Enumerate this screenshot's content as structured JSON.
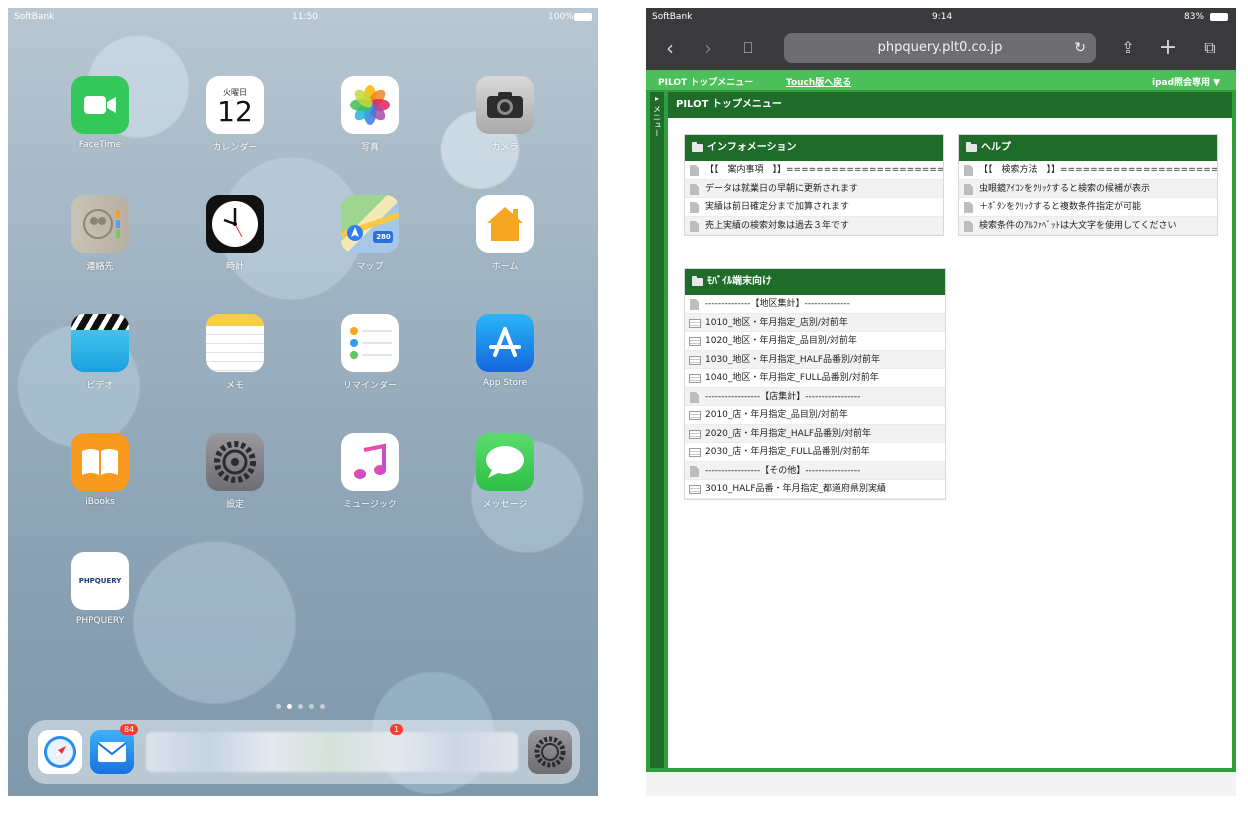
{
  "home": {
    "status": {
      "carrier": "SoftBank",
      "time": "11:50",
      "battery": "100%"
    },
    "apps": [
      {
        "label": "FaceTime",
        "icon": "facetime-icon"
      },
      {
        "label": "カレンダー",
        "icon": "calendar-icon",
        "weekday": "火曜日",
        "day": "12"
      },
      {
        "label": "写真",
        "icon": "photos-icon"
      },
      {
        "label": "カメラ",
        "icon": "camera-icon"
      },
      {
        "label": "連絡先",
        "icon": "contacts-icon"
      },
      {
        "label": "時計",
        "icon": "clock-icon"
      },
      {
        "label": "マップ",
        "icon": "maps-icon",
        "route": "280"
      },
      {
        "label": "ホーム",
        "icon": "home-app-icon"
      },
      {
        "label": "ビデオ",
        "icon": "videos-icon"
      },
      {
        "label": "メモ",
        "icon": "notes-icon"
      },
      {
        "label": "リマインダー",
        "icon": "reminders-icon"
      },
      {
        "label": "App Store",
        "icon": "app-store-icon"
      },
      {
        "label": "iBooks",
        "icon": "ibooks-icon"
      },
      {
        "label": "設定",
        "icon": "settings-icon"
      },
      {
        "label": "ミュージック",
        "icon": "music-icon"
      },
      {
        "label": "メッセージ",
        "icon": "messages-icon"
      },
      {
        "label": "PHPQUERY",
        "icon": "phpquery-icon",
        "logo_text": "PHPQUERY"
      }
    ],
    "page_dots": 5,
    "page_current": 2,
    "dock": {
      "mail_badge": "84",
      "other_badge": "1"
    }
  },
  "safari": {
    "status": {
      "carrier": "SoftBank",
      "time": "9:14",
      "battery": "83%"
    },
    "url": "phpquery.plt0.co.jp",
    "menu": {
      "title": "PILOT トップメニュー",
      "touch_link": "Touch版へ戻る",
      "ipad_mode": "ipad照会専用 ▼"
    },
    "side_handle": "メニュー",
    "content_title": "PILOT トップメニュー",
    "panels": {
      "info": {
        "title": "インフォメーション",
        "rows": [
          "【【　案内事項　】】==========================",
          "データは就業日の早朝に更新されます",
          "実績は前日確定分まで加算されます",
          "売上実績の検索対象は過去３年です"
        ]
      },
      "help": {
        "title": "ヘルプ",
        "rows": [
          "【【　検索方法　】】==========================",
          "虫眼鏡ｱｲｺﾝをｸﾘｯｸすると検索の候補が表示",
          "＋ﾎﾞﾀﾝをｸﾘｯｸすると複数条件指定が可能",
          "検索条件のｱﾙﾌｧﾍﾞｯﾄは大文字を使用してください"
        ]
      },
      "mobile": {
        "title": "ﾓﾊﾞｲﾙ端末向け",
        "rows": [
          {
            "text": "--------------【地区集計】--------------",
            "kind": "doc"
          },
          {
            "text": "1010_地区・年月指定_店別/対前年",
            "kind": "tbl"
          },
          {
            "text": "1020_地区・年月指定_品目別/対前年",
            "kind": "tbl"
          },
          {
            "text": "1030_地区・年月指定_HALF品番別/対前年",
            "kind": "tbl"
          },
          {
            "text": "1040_地区・年月指定_FULL品番別/対前年",
            "kind": "tbl"
          },
          {
            "text": "-----------------【店集計】-----------------",
            "kind": "doc"
          },
          {
            "text": "2010_店・年月指定_品目別/対前年",
            "kind": "tbl"
          },
          {
            "text": "2020_店・年月指定_HALF品番別/対前年",
            "kind": "tbl"
          },
          {
            "text": "2030_店・年月指定_FULL品番別/対前年",
            "kind": "tbl"
          },
          {
            "text": "-----------------【その他】-----------------",
            "kind": "doc"
          },
          {
            "text": "3010_HALF品番・年月指定_都道府県別実績",
            "kind": "tbl"
          }
        ]
      }
    }
  }
}
